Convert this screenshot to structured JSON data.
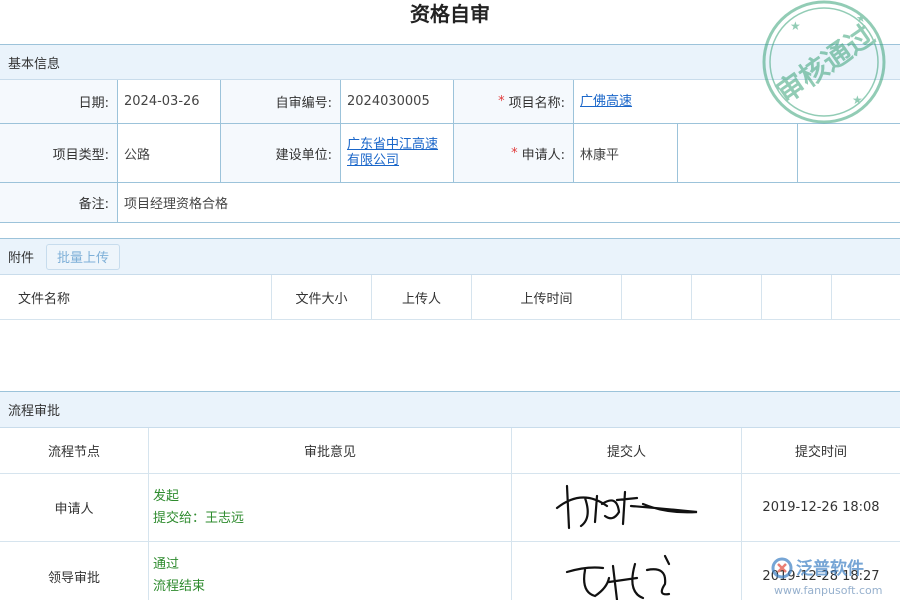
{
  "title": "资格自审",
  "basic": {
    "header": "基本信息",
    "date_label": "日期:",
    "date_value": "2024-03-26",
    "code_label": "自审编号:",
    "code_value": "2024030005",
    "project_label": "项目名称:",
    "project_value": "广佛高速",
    "type_label": "项目类型:",
    "type_value": "公路",
    "unit_label": "建设单位:",
    "unit_value_line1": "广东省中江高速",
    "unit_value_line2": "有限公司",
    "applicant_label": "申请人:",
    "applicant_value": "林康平",
    "remark_label": "备注:",
    "remark_value": "项目经理资格合格"
  },
  "attachments": {
    "header": "附件",
    "batch_upload": "批量上传",
    "columns": [
      "文件名称",
      "文件大小",
      "上传人",
      "上传时间"
    ]
  },
  "flow": {
    "header": "流程审批",
    "columns": [
      "流程节点",
      "审批意见",
      "提交人",
      "提交时间"
    ],
    "rows": [
      {
        "node": "申请人",
        "opinion1": "发起",
        "opinion2": "提交给：王志远",
        "time": "2019-12-26 18:08"
      },
      {
        "node": "领导审批",
        "opinion1": "通过",
        "opinion2": "流程结束",
        "time": "2019-12-28 18:27"
      }
    ]
  },
  "stamp": {
    "text": "审核通过",
    "color": "#3aa37a"
  },
  "watermark": {
    "brand": "泛普软件",
    "url": "www.fanpusoft.com"
  }
}
